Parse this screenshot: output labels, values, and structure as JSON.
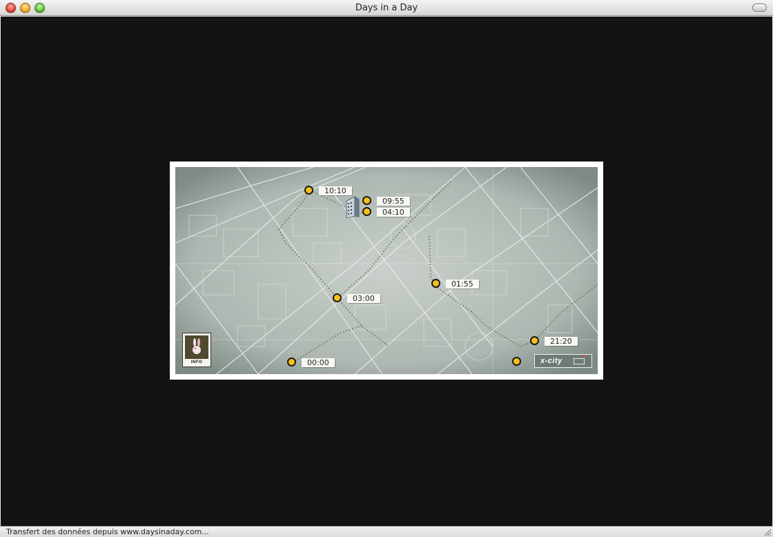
{
  "window": {
    "title": "Days in a Day"
  },
  "map": {
    "markers": [
      {
        "id": "m1010",
        "time": "10:10"
      },
      {
        "id": "m0955",
        "time": "09:55"
      },
      {
        "id": "m0410",
        "time": "04:10"
      },
      {
        "id": "m0300",
        "time": "03:00"
      },
      {
        "id": "m0155",
        "time": "01:55"
      },
      {
        "id": "m2120",
        "time": "21:20"
      },
      {
        "id": "m0000",
        "time": "00:00"
      }
    ],
    "info_label": "INFO",
    "logo_text": "x-city",
    "colors": {
      "marker": "#f6c21a",
      "background": "#141313",
      "map": "#aab3ad"
    }
  },
  "statusbar": {
    "text": "Transfert des données depuis www.daysinaday.com..."
  }
}
